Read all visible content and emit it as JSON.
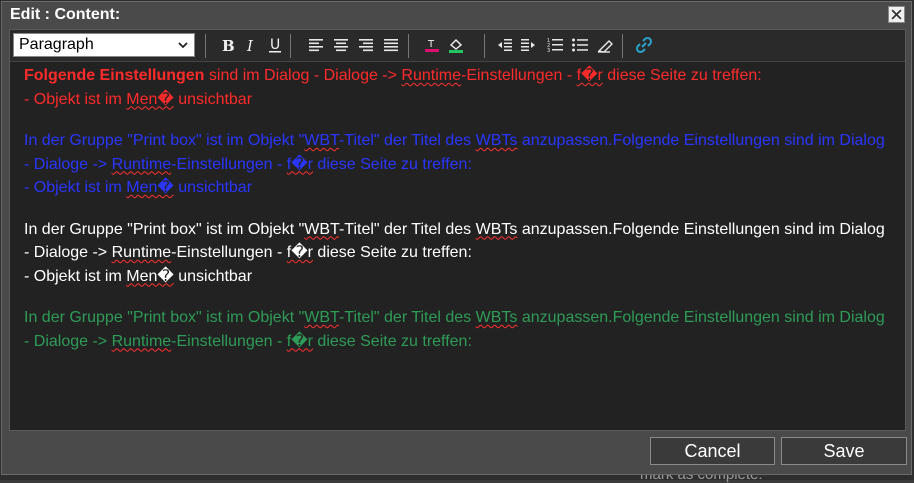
{
  "dialog": {
    "title": "Edit : Content:",
    "close_glyph": "✕"
  },
  "toolbar": {
    "format_value": "Paragraph",
    "buttons": [
      "bold",
      "italic",
      "underline",
      "align-left",
      "align-center",
      "align-right",
      "align-justify",
      "text-color",
      "background-color",
      "outdent",
      "indent",
      "ordered-list",
      "unordered-list",
      "clear-format",
      "link"
    ]
  },
  "content": {
    "p1": {
      "bold": "Folgende Einstellungen",
      "a": " sind im Dialog - Dialoge -> ",
      "runtime": "Runtime",
      "b": "-Einstellungen - ",
      "fuer": "f�r",
      "c": " diese Seite zu treffen:",
      "line2a": "- Objekt ist im ",
      "menu": "Men�",
      "line2b": " unsichtbar"
    },
    "p2": {
      "a": "In der Gruppe \"Print box\" ist im Objekt \"",
      "wbt": "WBT",
      "b": "-Titel\" der Titel des ",
      "wbts": "WBTs",
      "c": " anzupassen.Folgende Einstellungen sind im Dialog - Dialoge -> ",
      "runtime": "Runtime",
      "d": "-Einstellungen - ",
      "fuer": "f�r",
      "e": " diese Seite zu treffen:",
      "line3a": "- Objekt ist im ",
      "menu": "Men�",
      "line3b": " unsichtbar"
    },
    "p3": {
      "a": "In der Gruppe \"Print box\" ist im Objekt \"",
      "wbt": "WBT",
      "b": "-Titel\" der Titel des ",
      "wbts": "WBTs",
      "c": " anzupassen.Folgende Einstellungen sind im Dialog - Dialoge -> ",
      "runtime": "Runtime",
      "d": "-Einstellungen - ",
      "fuer": "f�r",
      "e": " diese Seite zu treffen:",
      "line3a": "- Objekt ist im ",
      "menu": "Men�",
      "line3b": " unsichtbar"
    },
    "p4": {
      "a": "In der Gruppe \"Print box\" ist im Objekt \"",
      "wbt": "WBT",
      "b": "-Titel\" der Titel des ",
      "wbts": "WBTs",
      "c": " anzupassen.Folgende Einstellungen sind im Dialog - Dialoge -> ",
      "runtime": "Runtime",
      "d": "-Einstellungen - ",
      "fuer": "f�r",
      "e": " diese Seite zu treffen:"
    }
  },
  "footer": {
    "cancel_label": "Cancel",
    "save_label": "Save"
  },
  "background": {
    "partial_text": "mark as complete:"
  },
  "colors": {
    "red": "#ff2a2a",
    "blue": "#2a36ff",
    "white": "#ffffff",
    "green": "#2e9c58",
    "dialog_bg": "#4a4a4a",
    "editor_bg": "#222222"
  }
}
